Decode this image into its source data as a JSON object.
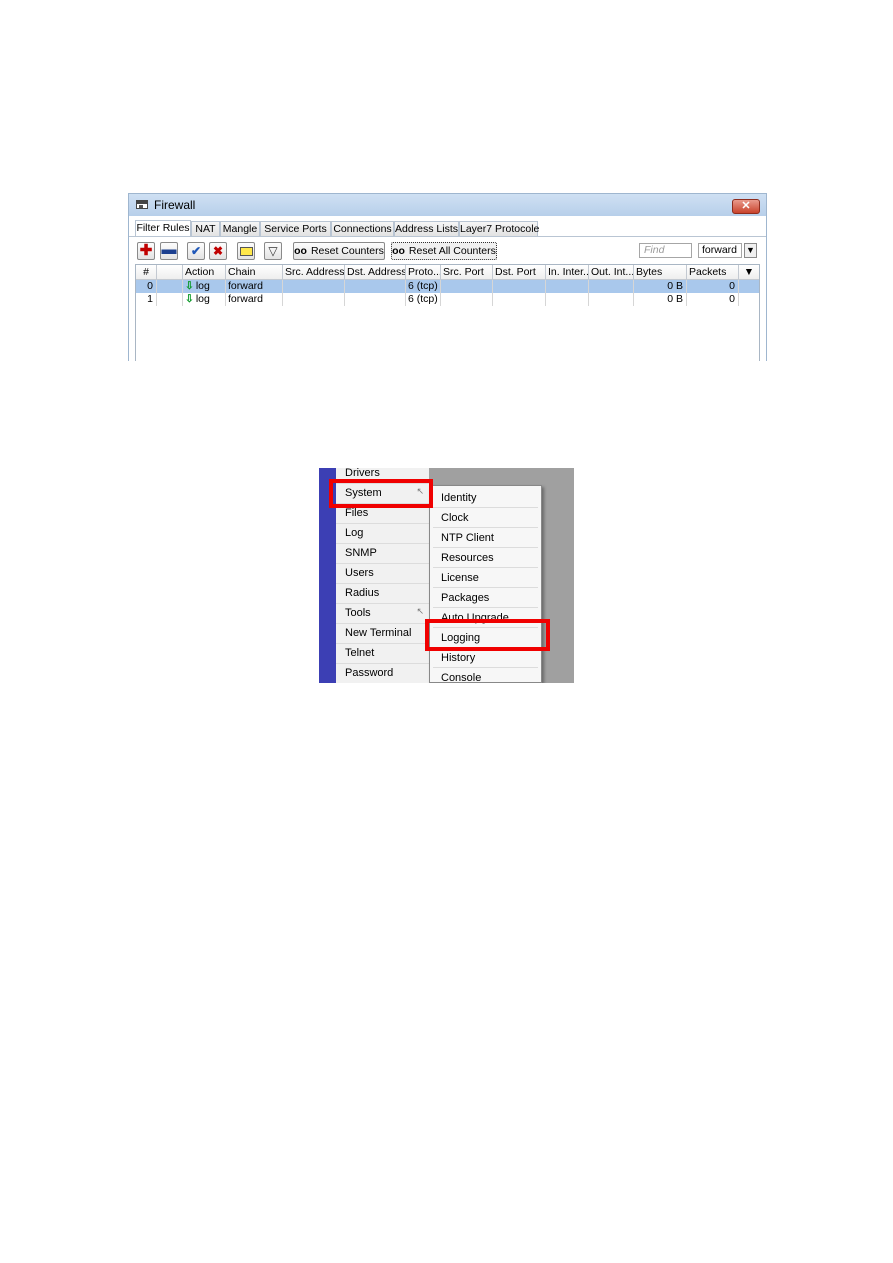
{
  "firewall": {
    "title": "Firewall",
    "close_label": "✕",
    "tabs": [
      "Filter Rules",
      "NAT",
      "Mangle",
      "Service Ports",
      "Connections",
      "Address Lists",
      "Layer7 Protocole"
    ],
    "toolbar": {
      "add_icon": "plus-icon",
      "remove_icon": "minus-icon",
      "enable_icon": "check-icon",
      "disable_icon": "x-icon",
      "comment_icon": "note-icon",
      "filter_icon": "funnel-icon",
      "reset_counters_label": "Reset Counters",
      "reset_all_counters_label": "Reset All Counters",
      "counter_glyph": "oo"
    },
    "find_placeholder": "Find",
    "chain_filter_value": "forward",
    "columns": [
      "#",
      "",
      "Action",
      "Chain",
      "Src. Address",
      "Dst. Address",
      "Proto...",
      "Src. Port",
      "Dst. Port",
      "In. Inter...",
      "Out. Int...",
      "Bytes",
      "Packets"
    ],
    "rows": [
      {
        "num": "0",
        "action": "log",
        "chain": "forward",
        "src_address": "",
        "dst_address": "",
        "protocol": "6 (tcp)",
        "src_port": "",
        "dst_port": "",
        "in_interface": "",
        "out_interface": "",
        "bytes": "0 B",
        "packets": "0"
      },
      {
        "num": "1",
        "action": "log",
        "chain": "forward",
        "src_address": "",
        "dst_address": "",
        "protocol": "6 (tcp)",
        "src_port": "",
        "dst_port": "",
        "in_interface": "",
        "out_interface": "",
        "bytes": "0 B",
        "packets": "0"
      }
    ],
    "selected_row": 0
  },
  "menu": {
    "items": [
      "Drivers",
      "System",
      "Files",
      "Log",
      "SNMP",
      "Users",
      "Radius",
      "Tools",
      "New Terminal",
      "Telnet",
      "Password"
    ],
    "submenu_items": [
      "Identity",
      "Clock",
      "NTP Client",
      "Resources",
      "License",
      "Packages",
      "Auto Upgrade",
      "Logging",
      "History",
      "Console"
    ],
    "highlighted_item": "System",
    "highlighted_submenu_item": "Logging",
    "highlight_color": "#f00000"
  }
}
